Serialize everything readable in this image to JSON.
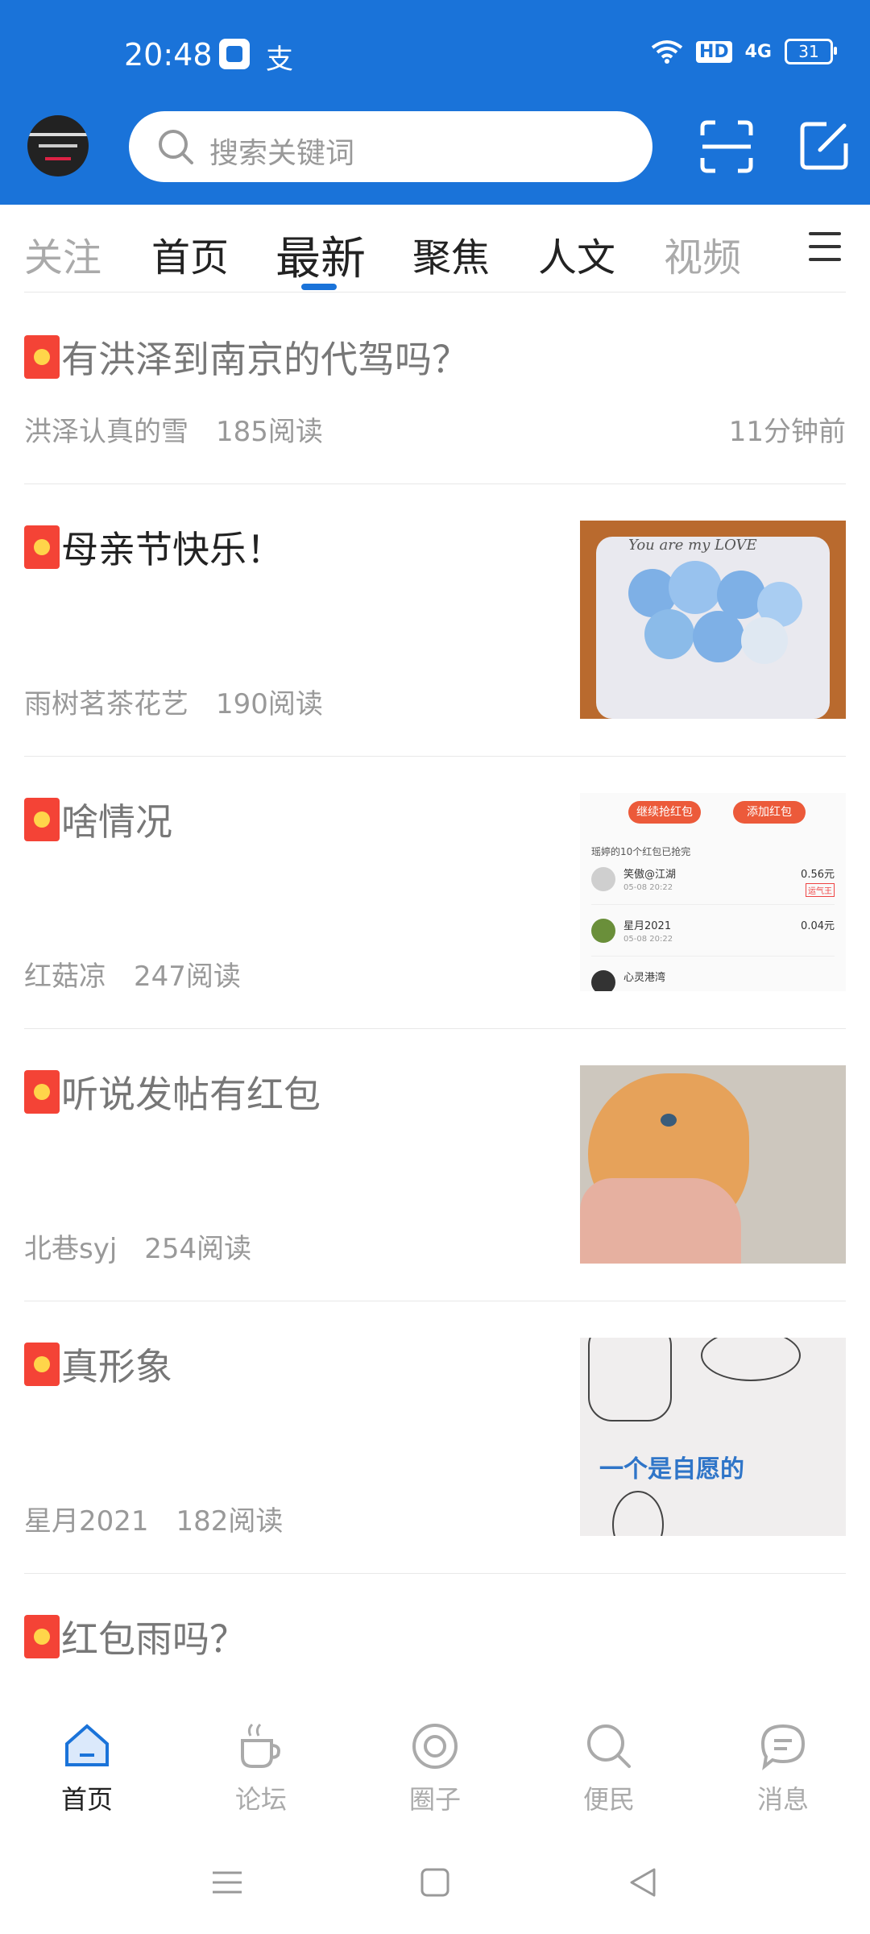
{
  "status_bar": {
    "time": "20:48",
    "app_icon_text": "支",
    "network": "4G",
    "hd": "HD",
    "battery": "31"
  },
  "header": {
    "search_placeholder": "搜索关键词"
  },
  "tabs": [
    {
      "label": "关注"
    },
    {
      "label": "首页"
    },
    {
      "label": "最新"
    },
    {
      "label": "聚焦"
    },
    {
      "label": "人文"
    },
    {
      "label": "视频"
    }
  ],
  "active_tab": "最新",
  "posts": [
    {
      "title": "有洪泽到南京的代驾吗？",
      "author": "洪泽认真的雪",
      "reads": "185阅读",
      "time": "11分钟前"
    },
    {
      "title": "母亲节快乐！",
      "author": "雨树茗茶花艺",
      "reads": "190阅读",
      "time": ""
    },
    {
      "title": "啥情况",
      "author": "红菇凉",
      "reads": "247阅读",
      "time": ""
    },
    {
      "title": "听说发帖有红包",
      "author": "北巷syj",
      "reads": "254阅读",
      "time": ""
    },
    {
      "title": "真形象",
      "author": "星月2021",
      "reads": "182阅读",
      "time": ""
    },
    {
      "title": "红包雨吗？",
      "author": "",
      "reads": "",
      "time": ""
    }
  ],
  "thumbs": {
    "flowers_text": "You are my LOVE",
    "redpack": {
      "btn_continue": "继续抢红包",
      "btn_add": "添加红包",
      "summary": "瑶婷的10个红包已抢完",
      "rows": [
        {
          "name": "笑傲@江湖",
          "time": "05-08 20:22",
          "amount": "0.56元",
          "badge": "运气王"
        },
        {
          "name": "星月2021",
          "time": "05-08 20:22",
          "amount": "0.04元"
        },
        {
          "name": "心灵港湾",
          "time": "",
          "amount": ""
        }
      ]
    },
    "comic_text": "一个是自愿的"
  },
  "bottom_nav": [
    {
      "label": "首页",
      "icon": "home-icon"
    },
    {
      "label": "论坛",
      "icon": "coffee-cup-icon"
    },
    {
      "label": "圈子",
      "icon": "circle-icon"
    },
    {
      "label": "便民",
      "icon": "search-icon"
    },
    {
      "label": "消息",
      "icon": "message-icon"
    }
  ],
  "colors": {
    "brand": "#1a73d9",
    "redpacket": "#f44336"
  }
}
